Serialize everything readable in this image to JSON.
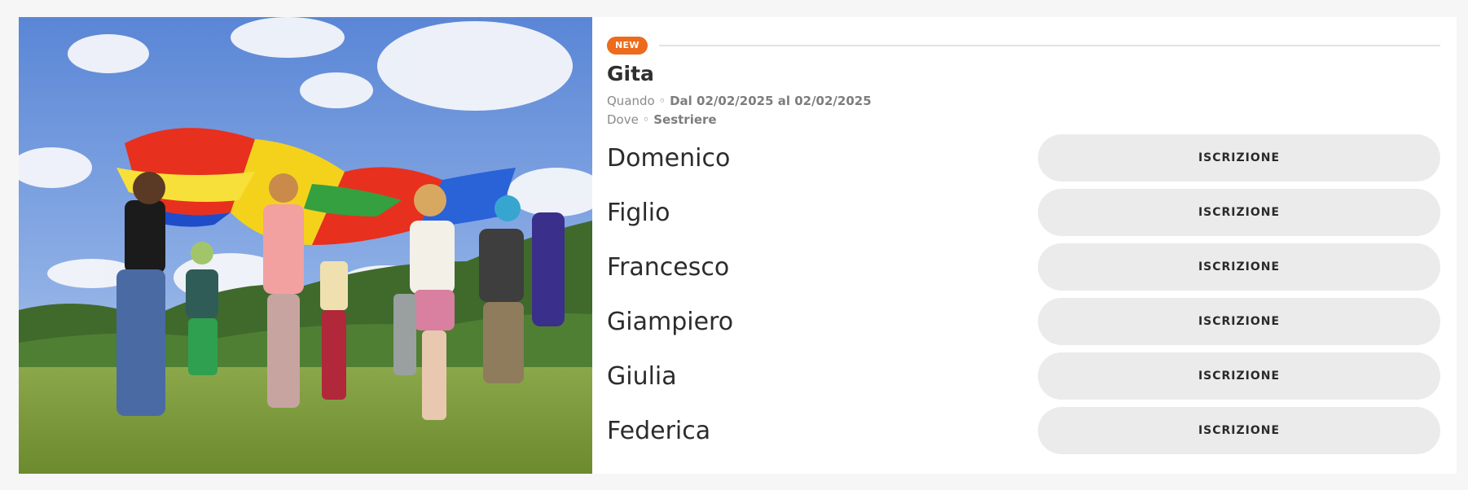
{
  "event": {
    "badge": "NEW",
    "title": "Gita",
    "when_label": "Quando ◦",
    "when_value": "Dal 02/02/2025 al 02/02/2025",
    "where_label": "Dove ◦",
    "where_value": "Sestriere",
    "image_alt": "Bambini che giocano con un paracadute colorato su un prato"
  },
  "participants": [
    {
      "name": "Domenico",
      "button_label": "ISCRIZIONE"
    },
    {
      "name": "Figlio",
      "button_label": "ISCRIZIONE"
    },
    {
      "name": "Francesco",
      "button_label": "ISCRIZIONE"
    },
    {
      "name": "Giampiero",
      "button_label": "ISCRIZIONE"
    },
    {
      "name": "Giulia",
      "button_label": "ISCRIZIONE"
    },
    {
      "name": "Federica",
      "button_label": "ISCRIZIONE"
    }
  ],
  "colors": {
    "badge": "#ec6b1c",
    "button_bg": "#ebebeb",
    "page_bg": "#f6f6f6"
  }
}
